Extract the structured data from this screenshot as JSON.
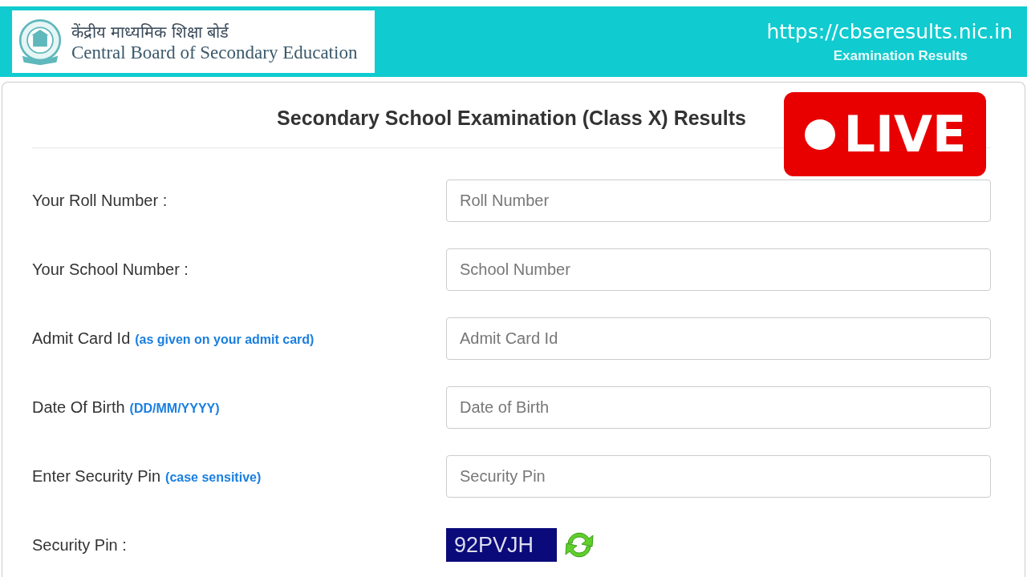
{
  "header": {
    "title_hindi": "केंद्रीय माध्यमिक शिक्षा बोर्ड",
    "title_english": "Central Board of Secondary Education",
    "url": "https://cbseresults.nic.in",
    "subtitle": "Examination Results"
  },
  "live_badge": {
    "label": "LIVE"
  },
  "form": {
    "title": "Secondary School Examination (Class X) Results",
    "rows": [
      {
        "kind": "input",
        "label": "Your Roll Number :",
        "placeholder": "Roll Number"
      },
      {
        "kind": "input",
        "label": "Your School Number :",
        "placeholder": "School Number"
      },
      {
        "kind": "input",
        "label": "Admit Card Id",
        "hint": "(as given on your admit card)",
        "placeholder": "Admit Card Id"
      },
      {
        "kind": "input",
        "label": "Date Of Birth",
        "hint": "(DD/MM/YYYY)",
        "placeholder": "Date of Birth"
      },
      {
        "kind": "input",
        "label": "Enter Security Pin",
        "hint": "(case sensitive)",
        "placeholder": "Security Pin"
      },
      {
        "kind": "captcha",
        "label": "Security Pin :",
        "captcha": "92PVJH"
      }
    ]
  }
}
